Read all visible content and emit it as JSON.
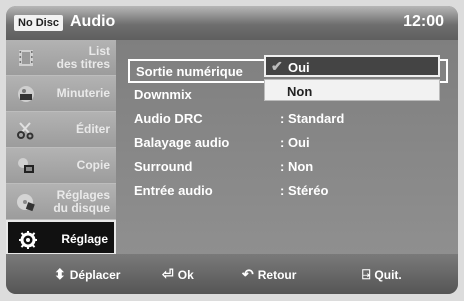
{
  "header": {
    "badge": "No Disc",
    "title": "Audio",
    "time": "12:00"
  },
  "sidebar": {
    "items": [
      {
        "label": "List\ndes titres",
        "icon": "film-strip-icon",
        "active": false
      },
      {
        "label": "Minuterie",
        "icon": "timer-record-icon",
        "active": false
      },
      {
        "label": "Éditer",
        "icon": "scissors-icon",
        "active": false
      },
      {
        "label": "Copie",
        "icon": "copy-icon",
        "active": false
      },
      {
        "label": "Réglages\ndu disque",
        "icon": "disc-settings-icon",
        "active": false
      },
      {
        "label": "Réglage",
        "icon": "gear-icon",
        "active": true
      }
    ]
  },
  "settings": {
    "rows": [
      {
        "label": "Sortie numérique",
        "value": ""
      },
      {
        "label": "Downmix",
        "value": ""
      },
      {
        "label": "Audio DRC",
        "value": ": Standard"
      },
      {
        "label": "Balayage audio",
        "value": ": Oui"
      },
      {
        "label": "Surround",
        "value": ": Non"
      },
      {
        "label": "Entrée audio",
        "value": ": Stéréo"
      }
    ]
  },
  "dropdown": {
    "options": [
      {
        "label": "Oui",
        "selected": true
      },
      {
        "label": "Non",
        "selected": false
      }
    ]
  },
  "footer": {
    "move": "Déplacer",
    "ok": "Ok",
    "back": "Retour",
    "exit": "Quit."
  },
  "colors": {
    "accent_border": "#ffffff",
    "active_bg": "#111111",
    "panel_bg": "#8a8a8a"
  }
}
